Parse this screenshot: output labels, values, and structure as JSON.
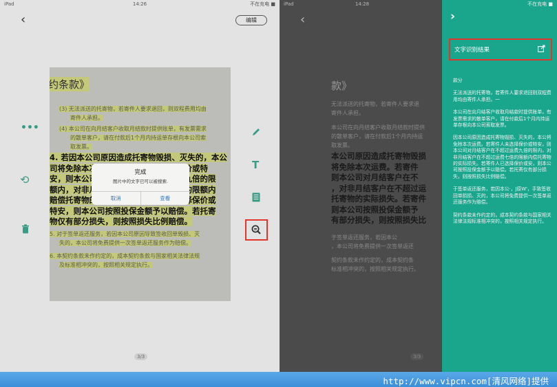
{
  "left": {
    "status": {
      "device": "iPad",
      "time": "14:26",
      "battery": "不在充电 ■"
    },
    "edit_label": "编辑",
    "doc": {
      "title": "约条款》",
      "item3_line1": "(3)  无法派送的托寄物，若寄件人要求退回，则双程费用均由",
      "item3_line2": "寄件人承担。",
      "item4_line1": "(4)  本公司在向月结客户收取月结款时提供账单，有发票需求",
      "item4_line2": "的散单客户，请在付款后1个月内持运单存根向本公司索",
      "item4_line3": "取发票。",
      "big_lines": [
        "4. 若因本公司原因造成托寄物毁损、灭失的，本公",
        "司将免除本次运费。若寄件人未选择保价或特",
        "安，则本公司对月结客户在不超过运费九倍的限",
        "额内，对非月结客户在不超过运费七倍的限额内",
        "赔偿托寄物的实际损失。若寄件人已选择保价或",
        "特安，则本公司按照投保金额予以赔偿。若托寄",
        "物仅有部分损失，则按照损失比例赔偿。"
      ],
      "item5_line1": "5. 对于签单返还服务，若因本公司原因导致签收回单毁损、灭",
      "item5_line2": "失的，本公司将免费提供一次签单返还服务作为赔偿。",
      "item6_line1": "6. 本契约条款未作约定的，成本契约条款与国家相关法律法规",
      "item6_line2": "及标准相冲突的，按照相关规定执行。",
      "page": "3/3"
    },
    "dialog": {
      "title": "完成",
      "message": "图片中的文字已可以被搜索.",
      "cancel": "取消",
      "view": "查看"
    },
    "icons": [
      "more-icon",
      "undo-icon",
      "trash-icon",
      "pen-icon",
      "text-icon",
      "document-icon",
      "text-search-icon"
    ]
  },
  "right": {
    "status": {
      "device": "iPad",
      "time": "14:28",
      "battery": "不在充电 ■"
    },
    "doc": {
      "title": "款》",
      "small_lines": [
        "无法派送的托寄物，若寄件人要求退",
        "寄件人承担。",
        "本公司在向月结客户收取月结款时提供",
        "的散单客户，请在付款后1个月内持运",
        "取发票。"
      ],
      "big_lines": [
        "本公司原因造成托寄物毁损",
        "将免除本次运费。若寄件",
        "则本公司对月结客户在不",
        "，对非月结客户在不超过运",
        "托寄物的实际损失。若寄件",
        "则本公司按照投保金额予",
        "有部分损失，则按照损失比"
      ],
      "tail_lines": [
        "于签单返还服务，若因本公",
        "，本公司将免费提供一次签单返还",
        "契约条款未作约定的，成本契约条",
        "标准相冲突的，按照相关规定执行。"
      ],
      "page": "3/3"
    },
    "drawer": {
      "status": "不在充电 ■",
      "result_label": "文字识别结果",
      "ocr_paragraphs": [
        "款分",
        "无法派送的托寄物，若寄件人要求退回则双程费用均由寄件人承担。一",
        "本公司在向月结客户收取月结款时提供账单，有发票需求的散单客户，请在付款后1个月内持运单存根向本公司索取发票。",
        "因本公司原因造成托寄物毁损、灭失的，本公将免除本次运费。若寄件人未选择保价或特安，则本公司对月结客户在不超过运费九倍的限内，对非月结客户在不超过运费七倍的限额内偿托寄物的实际损失。若寄件人已选择保价或安，则本公司按照投保金额予以赔偿。若托寄仅有部分损失，则按照损失比例赔偿。",
        "于签单返还服务，若因本公·，J原W'，手致签收回单损损、灭的，本公司将免费提供一次签单返还服务作为赔偿。",
        "契约条款未作约定的，成本契约条款与国家相关法律法规标准相冲突的，按照相关规定执行。"
      ]
    }
  },
  "footer": {
    "text": "http://www.vipcn.com[清风网络]提供"
  },
  "colors": {
    "accent": "#1aa58d",
    "highlight_box": "#e2362d",
    "dialog_link": "#3178c6"
  }
}
